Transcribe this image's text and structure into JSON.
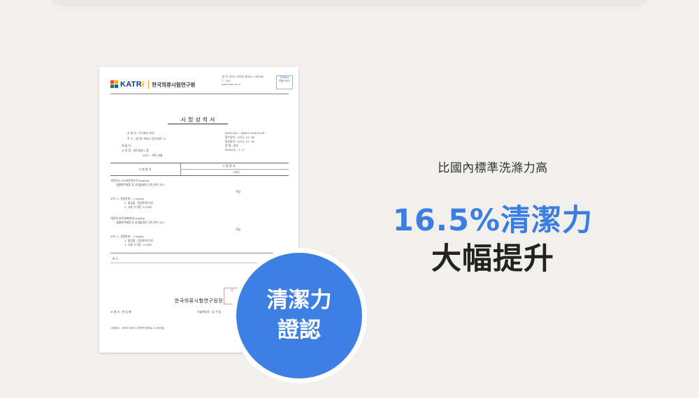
{
  "certificate": {
    "logo_text": "KATR",
    "logo_i": "i",
    "institute_name": "한국의류시험연구원",
    "address_lines": [
      "경기도 양주시 광적면 광적로 2 (양주동)",
      "T : 031-",
      "www.katri.re.kr"
    ],
    "stamp_box_lines": [
      "전자문서",
      "민원서비스"
    ],
    "title": "시험성적서",
    "meta_lines": [
      "신 청 자 : 주식회사 한진",
      "주      소 : 경기도 화성시 동탄대로 13",
      "KATRI NO. : SBDC2-00001249",
      "접수일자 : 2022. 12. 08",
      "발급일자 : 2022. 12. 16",
      "발      행 : 원본",
      "PAGE(S) : 1 / 3",
      "제 출 자 :",
      "시 료 명 : 세탁세제 1 종",
      "시료1 : 세탁 세제"
    ],
    "table_head": {
      "item": "시 험 항 목",
      "result": "시 험 결 과",
      "sample": "시료1"
    },
    "body_lines": [
      "세정력(2.0%세정력지수)(mg/kg)",
      "생활화학제품 및 살생물제의 안전 관리 고시",
      "적합",
      "※주) 1. 정량한계 : 1 mg/kg",
      "2. 불검출 : 정량한계 미만",
      "3. 사용 기기명 : LC/MS",
      "세정력(표준세제대비)(mg/kg)",
      "생활화학제품 및 살생물제의 안전 관리 고시",
      "적합",
      "※주) 1. 정량한계 : 1 mg/kg",
      "2. 불검출 : 정량한계 미만",
      "3. 사용 기기명 : LC/MS",
      "- 계 속 -"
    ],
    "seal_line": "한국의류시험연구원장",
    "seal_text": "印",
    "signer_left": "시 험 자 : 한 성 배",
    "signer_right": "기술책임자 : 김 기 훈",
    "footer": "시험장소 : 경기도 양주시 광적면 광적로 2 (양주동)"
  },
  "badge": {
    "line1": "清潔力",
    "line2": "證認"
  },
  "copy": {
    "sub": "比國內標準洗滌力高",
    "headline_blue": "16.5%清潔力",
    "headline_dark": "大幅提升"
  },
  "colors": {
    "accent_blue": "#3d7fe3",
    "background": "#f2f0ec"
  }
}
